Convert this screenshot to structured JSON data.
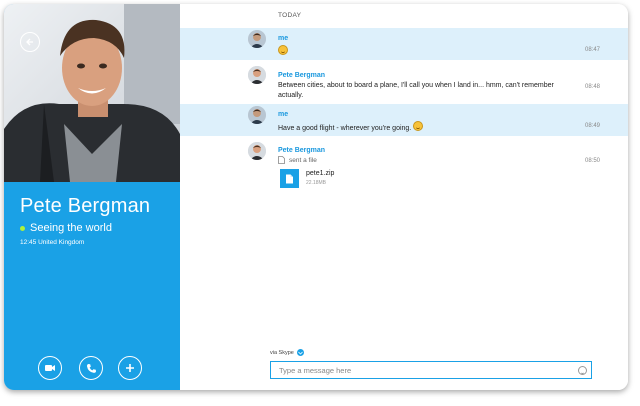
{
  "contact": {
    "name": "Pete Bergman",
    "mood": "Seeing the world",
    "local_time": "12:45 United Kingdom"
  },
  "conversation": {
    "day_label": "TODAY",
    "messages": [
      {
        "sender": "me",
        "text": "",
        "time": "08:47",
        "emoji": "smile"
      },
      {
        "sender": "Pete Bergman",
        "text": "Between cities, about to board a plane, I'll call you when I land in... hmm, can't remember actually.",
        "time": "08:48"
      },
      {
        "sender": "me",
        "text": "Have a good flight - wherever you're going.",
        "time": "08:49",
        "emoji": "grin"
      },
      {
        "sender": "Pete Bergman",
        "time": "08:50",
        "file_action": "sent a file",
        "file_name": "pete1.zip",
        "file_size": "22.18MB"
      }
    ]
  },
  "composer": {
    "via_label": "via Skype",
    "placeholder": "Type a message here"
  },
  "icons": {
    "back": "back-arrow-icon",
    "video": "video-call-icon",
    "audio": "phone-icon",
    "add": "add-icon",
    "file": "file-icon",
    "emoticon": "smiley-icon"
  },
  "colors": {
    "accent": "#1aa1e6",
    "highlight": "#ddf0fb",
    "presence": "#aef13b"
  }
}
